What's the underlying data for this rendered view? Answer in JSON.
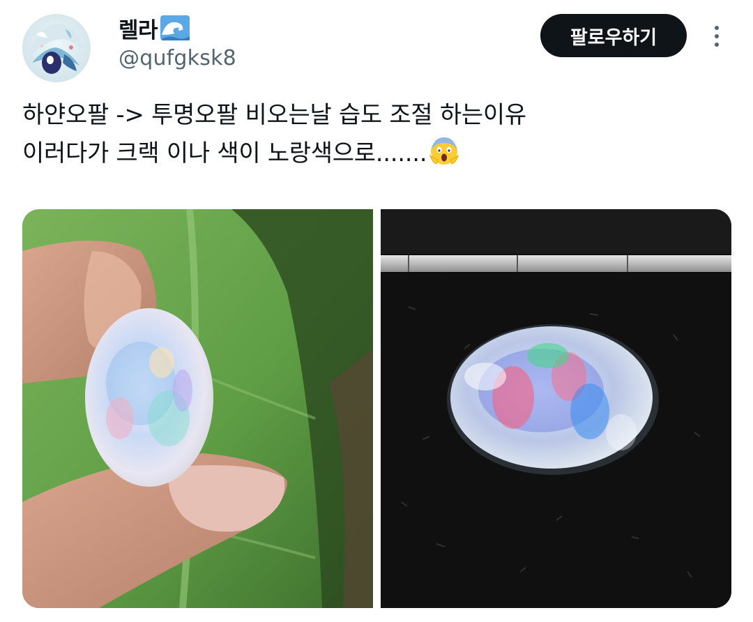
{
  "author": {
    "display_name": "렐라",
    "handle": "@qufgksk8",
    "avatar_icon": "anime-avatar-icon",
    "name_emoji_icon": "water-wave-icon"
  },
  "actions": {
    "follow_label": "팔로우하기",
    "more_icon": "more-vertical-icon"
  },
  "tweet": {
    "line1": "하얀오팔 -> 투명오팔 비오는날 습도 조절 하는이유",
    "line2": "이러다가 크랙 이나 색이 노랑색으로.......",
    "trailing_emoji_icon": "face-screaming-in-fear-icon"
  },
  "media": {
    "photos": [
      {
        "subject": "white opal held between fingers",
        "icon": "photo-white-opal"
      },
      {
        "subject": "transparent opal on black velvet",
        "icon": "photo-transparent-opal"
      }
    ]
  },
  "colors": {
    "text_primary": "#0f1419",
    "text_secondary": "#536471",
    "button_bg": "#0f1419",
    "button_text": "#ffffff"
  }
}
